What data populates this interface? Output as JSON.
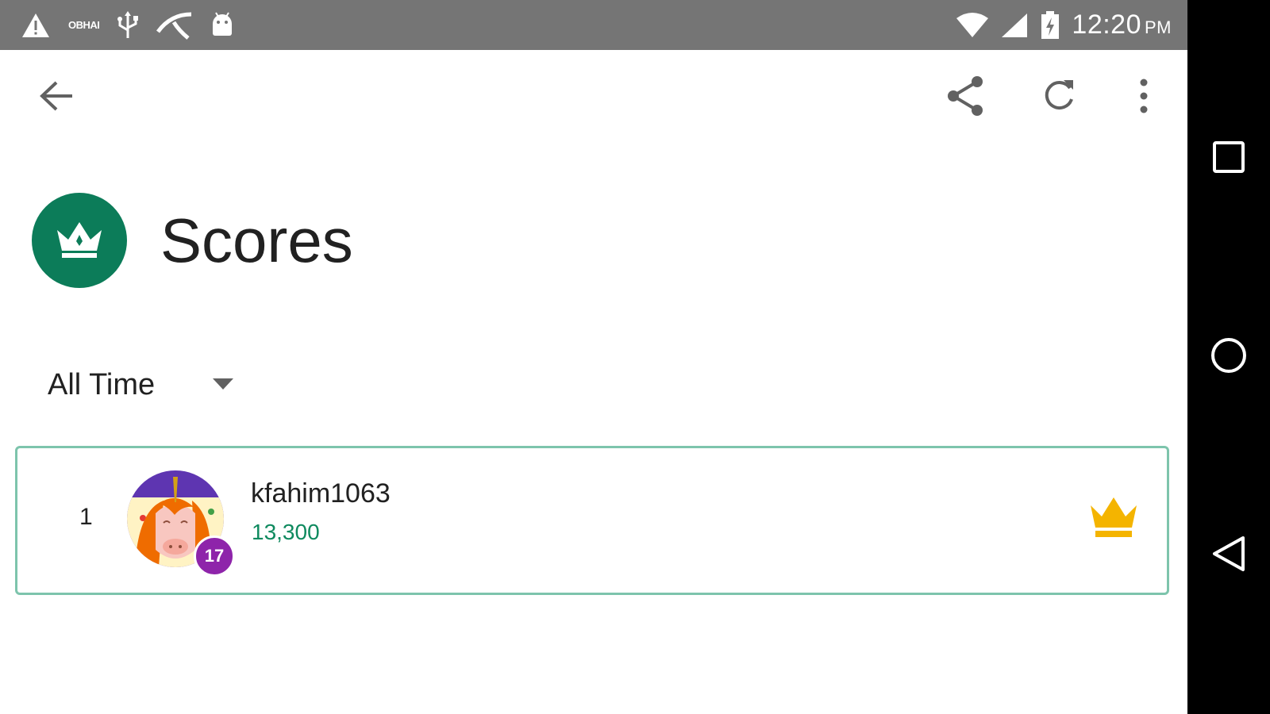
{
  "status_bar": {
    "carrier_label": "OBHAI",
    "time": "12:20",
    "ampm": "PM",
    "icons": [
      "warning-icon",
      "usb-icon",
      "carrier-app-icon",
      "android-icon",
      "wifi-icon",
      "signal-icon",
      "battery-charging-icon"
    ]
  },
  "app_bar": {
    "icons": [
      "back-arrow-icon",
      "share-icon",
      "refresh-icon",
      "more-vert-icon"
    ]
  },
  "header": {
    "title": "Scores",
    "badge_icon": "crown-icon",
    "badge_color": "#0c7c59"
  },
  "filter": {
    "selected": "All Time"
  },
  "leaderboard": {
    "entries": [
      {
        "rank": "1",
        "name": "kfahim1063",
        "score": "13,300",
        "level": "17",
        "trophy_icon": "crown-icon"
      }
    ]
  },
  "colors": {
    "accent": "#0c7c59",
    "score_text": "#0f8a5f",
    "card_border": "#7dc4ac",
    "level_badge": "#8e24aa",
    "gold_crown": "#f4b400",
    "status_bar": "#757575",
    "nav_bar": "#000000"
  },
  "nav_bar": {
    "icons": [
      "recents-square-icon",
      "home-circle-icon",
      "back-triangle-icon"
    ]
  }
}
